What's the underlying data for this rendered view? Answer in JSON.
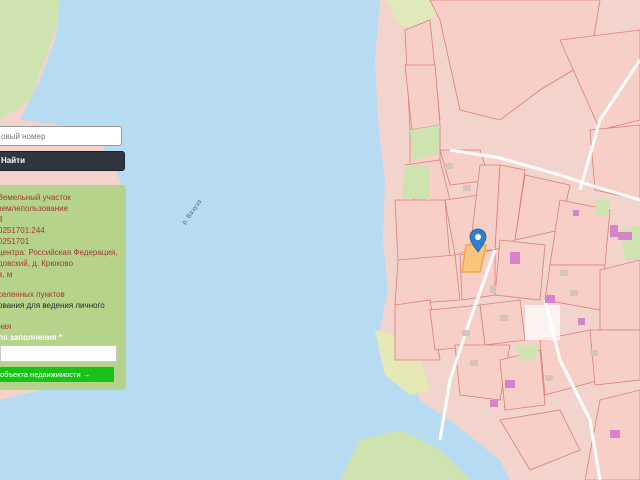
{
  "map": {
    "river_label": "р. Вазуза",
    "colors": {
      "water": "#b7dcf1",
      "land": "#f3d4cc",
      "parcel_fill": "#f7cfc6",
      "parcel_stroke": "#d97f78",
      "greenery": "#cfe3b0",
      "building": "#d783c9",
      "marker": "#2d7fd1",
      "selected_parcel": "#f0a64a"
    }
  },
  "search": {
    "placeholder": "овый номер",
    "button_label": "Найти"
  },
  "info": {
    "lines": [
      "Земельный участок",
      "землепользование",
      "3",
      "0251701:244",
      "0251701",
      "центра: Российская Федерация,",
      "довский, д. Крюково",
      "в, м",
      "",
      "селенных пунктов",
      "ования для ведения личного",
      "",
      "ная",
      "ля заполнения *"
    ],
    "button_label": "объекта недвижимости →"
  }
}
